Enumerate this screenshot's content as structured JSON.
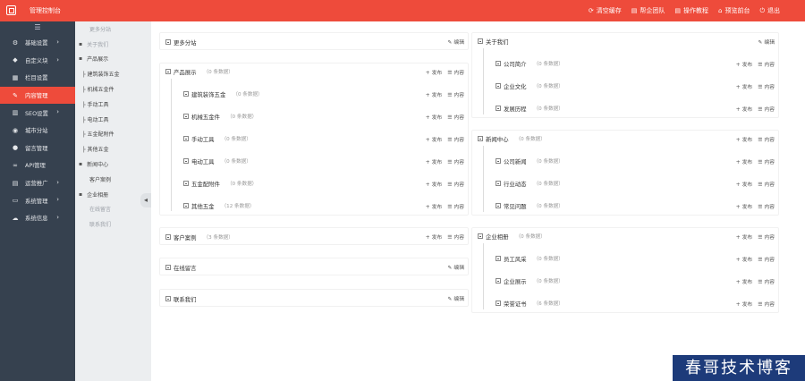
{
  "topbar": {
    "title": "管理控制台",
    "actions": [
      {
        "label": "清空缓存",
        "icon": "refresh-icon"
      },
      {
        "label": "帮企团队",
        "icon": "book-icon"
      },
      {
        "label": "操作教程",
        "icon": "book-icon"
      },
      {
        "label": "预览前台",
        "icon": "home-icon"
      },
      {
        "label": "退出",
        "icon": "power-icon"
      }
    ]
  },
  "sidebar": {
    "toggle": "☰",
    "items": [
      {
        "label": "基础设置",
        "icon": "gear-icon",
        "chevron": "›"
      },
      {
        "label": "自定义块",
        "icon": "tag-icon",
        "chevron": "›"
      },
      {
        "label": "栏目设置",
        "icon": "grid-icon",
        "chevron": ""
      },
      {
        "label": "内容管理",
        "icon": "edit-icon",
        "chevron": ""
      },
      {
        "label": "SEO设置",
        "icon": "bar-chart-icon",
        "chevron": "›"
      },
      {
        "label": "城市分站",
        "icon": "globe-icon",
        "chevron": ""
      },
      {
        "label": "留言管理",
        "icon": "chat-icon",
        "chevron": ""
      },
      {
        "label": "API管理",
        "icon": "link-icon",
        "chevron": ""
      },
      {
        "label": "运营推广",
        "icon": "table-icon",
        "chevron": "›"
      },
      {
        "label": "系统管理",
        "icon": "monitor-icon",
        "chevron": "›"
      },
      {
        "label": "系统信息",
        "icon": "cloud-icon",
        "chevron": "›"
      }
    ],
    "active_index": 3
  },
  "subnav": {
    "items": [
      {
        "label": "更多分站",
        "fold": "",
        "level": "lvl1",
        "muted": true
      },
      {
        "label": "关于我们",
        "fold": "▪",
        "level": "lvl0",
        "muted": true
      },
      {
        "label": "产品展示",
        "fold": "▪",
        "level": "lvl0",
        "muted": false
      },
      {
        "label": "├ 建筑装饰五金",
        "fold": "",
        "level": "lvl2",
        "muted": false
      },
      {
        "label": "├ 机械五金件",
        "fold": "",
        "level": "lvl2",
        "muted": false
      },
      {
        "label": "├ 手动工具",
        "fold": "",
        "level": "lvl2",
        "muted": false
      },
      {
        "label": "├ 电动工具",
        "fold": "",
        "level": "lvl2",
        "muted": false
      },
      {
        "label": "├ 五金配附件",
        "fold": "",
        "level": "lvl2",
        "muted": false
      },
      {
        "label": "├ 其他五金",
        "fold": "",
        "level": "lvl2",
        "muted": false
      },
      {
        "label": "新闻中心",
        "fold": "▪",
        "level": "lvl0",
        "muted": false
      },
      {
        "label": "客户案例",
        "fold": "",
        "level": "lvl1",
        "muted": false
      },
      {
        "label": "企业相册",
        "fold": "▪",
        "level": "lvl0",
        "muted": false
      },
      {
        "label": "在线留言",
        "fold": "",
        "level": "lvl1",
        "muted": true
      },
      {
        "label": "联系我们",
        "fold": "",
        "level": "lvl1",
        "muted": true
      }
    ],
    "handle": "◂"
  },
  "labels": {
    "publish": "发布",
    "content": "内容",
    "edit": "编辑",
    "publish_icon": "+",
    "content_icon": "☰",
    "edit_icon": "✎"
  },
  "left_column": {
    "more_sites": {
      "label": "更多分站"
    },
    "products": {
      "label": "产品展示",
      "count": "（0 条数据）",
      "children": [
        {
          "label": "建筑装饰五金",
          "count": "（0 条数据）"
        },
        {
          "label": "机械五金件",
          "count": "（0 条数据）"
        },
        {
          "label": "手动工具",
          "count": "（0 条数据）"
        },
        {
          "label": "电动工具",
          "count": "（0 条数据）"
        },
        {
          "label": "五金配附件",
          "count": "（0 条数据）"
        },
        {
          "label": "其他五金",
          "count": "（12 条数据）"
        }
      ]
    },
    "cases": {
      "label": "客户案例",
      "count": "（3 条数据）"
    },
    "message": {
      "label": "在线留言"
    },
    "contact": {
      "label": "联系我们"
    }
  },
  "right_column": {
    "about": {
      "label": "关于我们",
      "children": [
        {
          "label": "公司简介",
          "count": "（0 条数据）"
        },
        {
          "label": "企业文化",
          "count": "（0 条数据）"
        },
        {
          "label": "发展历程",
          "count": "（0 条数据）"
        }
      ]
    },
    "news": {
      "label": "新闻中心",
      "count": "（0 条数据）",
      "children": [
        {
          "label": "公司新闻",
          "count": "（0 条数据）"
        },
        {
          "label": "行业动态",
          "count": "（0 条数据）"
        },
        {
          "label": "常见问题",
          "count": "（0 条数据）"
        }
      ]
    },
    "album": {
      "label": "企业相册",
      "count": "（0 条数据）",
      "children": [
        {
          "label": "员工风采",
          "count": "（0 条数据）"
        },
        {
          "label": "企业展示",
          "count": "（0 条数据）"
        },
        {
          "label": "荣誉证书",
          "count": "（6 条数据）"
        }
      ]
    }
  },
  "watermark": "春哥技术博客",
  "colors": {
    "accent": "#ee4b3b",
    "sidebar": "#36414f",
    "subnav": "#eceef0"
  }
}
